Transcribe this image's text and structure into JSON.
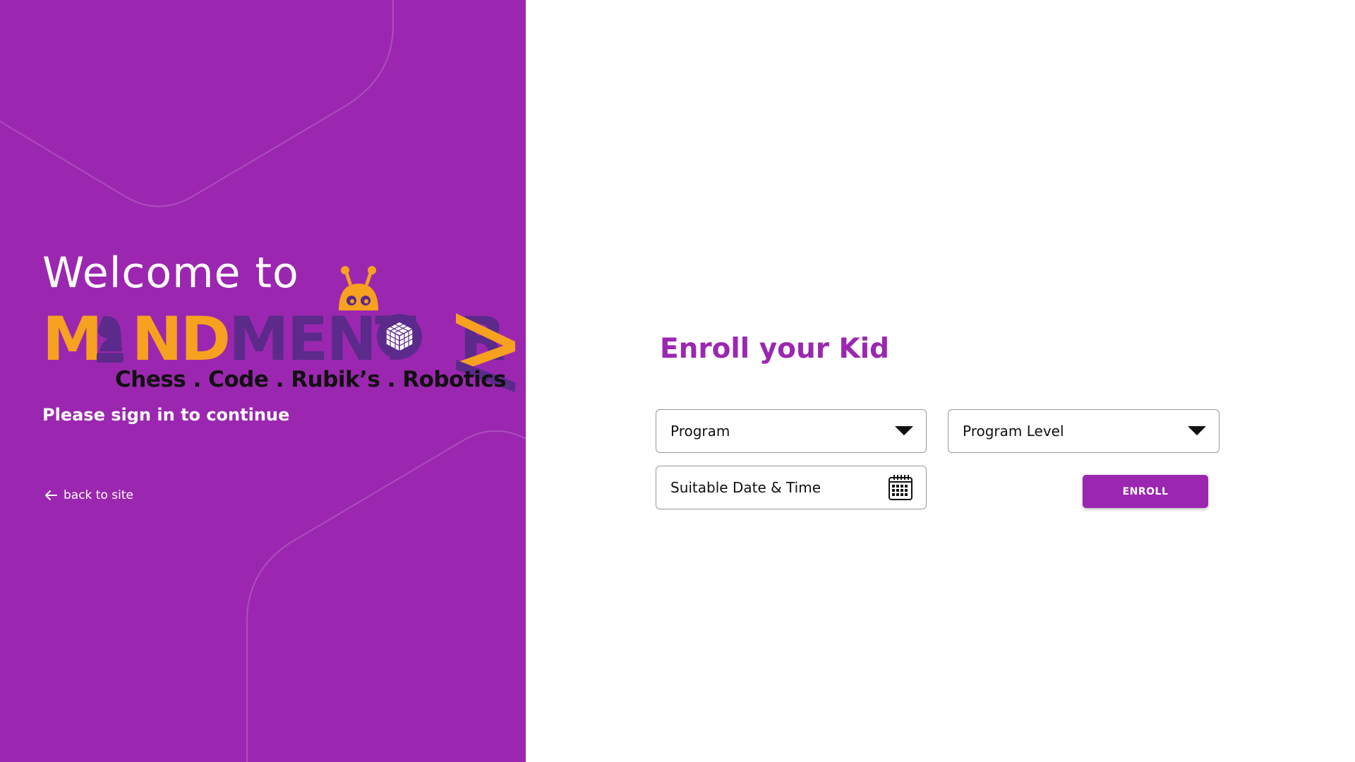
{
  "sidebar": {
    "welcome": "Welcome to",
    "logo": {
      "word_orange_1": "M",
      "word_orange_2": "ND",
      "word_dark": "MENT",
      "word_dark_2": "R",
      "tagline": "Chess . Code . Rubik’s . Robotics",
      "brand_orange": "#f6a11f",
      "brand_dark": "#5b2a8a"
    },
    "signin_text": "Please sign in to continue",
    "back_link": {
      "icon": "arrow-left-icon",
      "label": "back to site"
    },
    "background_color": "#9b27b0"
  },
  "form": {
    "title": "Enroll your Kid",
    "program": {
      "label": "Program",
      "icon": "caret-down-icon"
    },
    "program_level": {
      "label": "Program Level",
      "icon": "caret-down-icon"
    },
    "date_time": {
      "label": "Suitable Date & Time",
      "icon": "calendar-icon"
    },
    "enroll_button": "ENROLL",
    "accent_color": "#9b27b0"
  }
}
